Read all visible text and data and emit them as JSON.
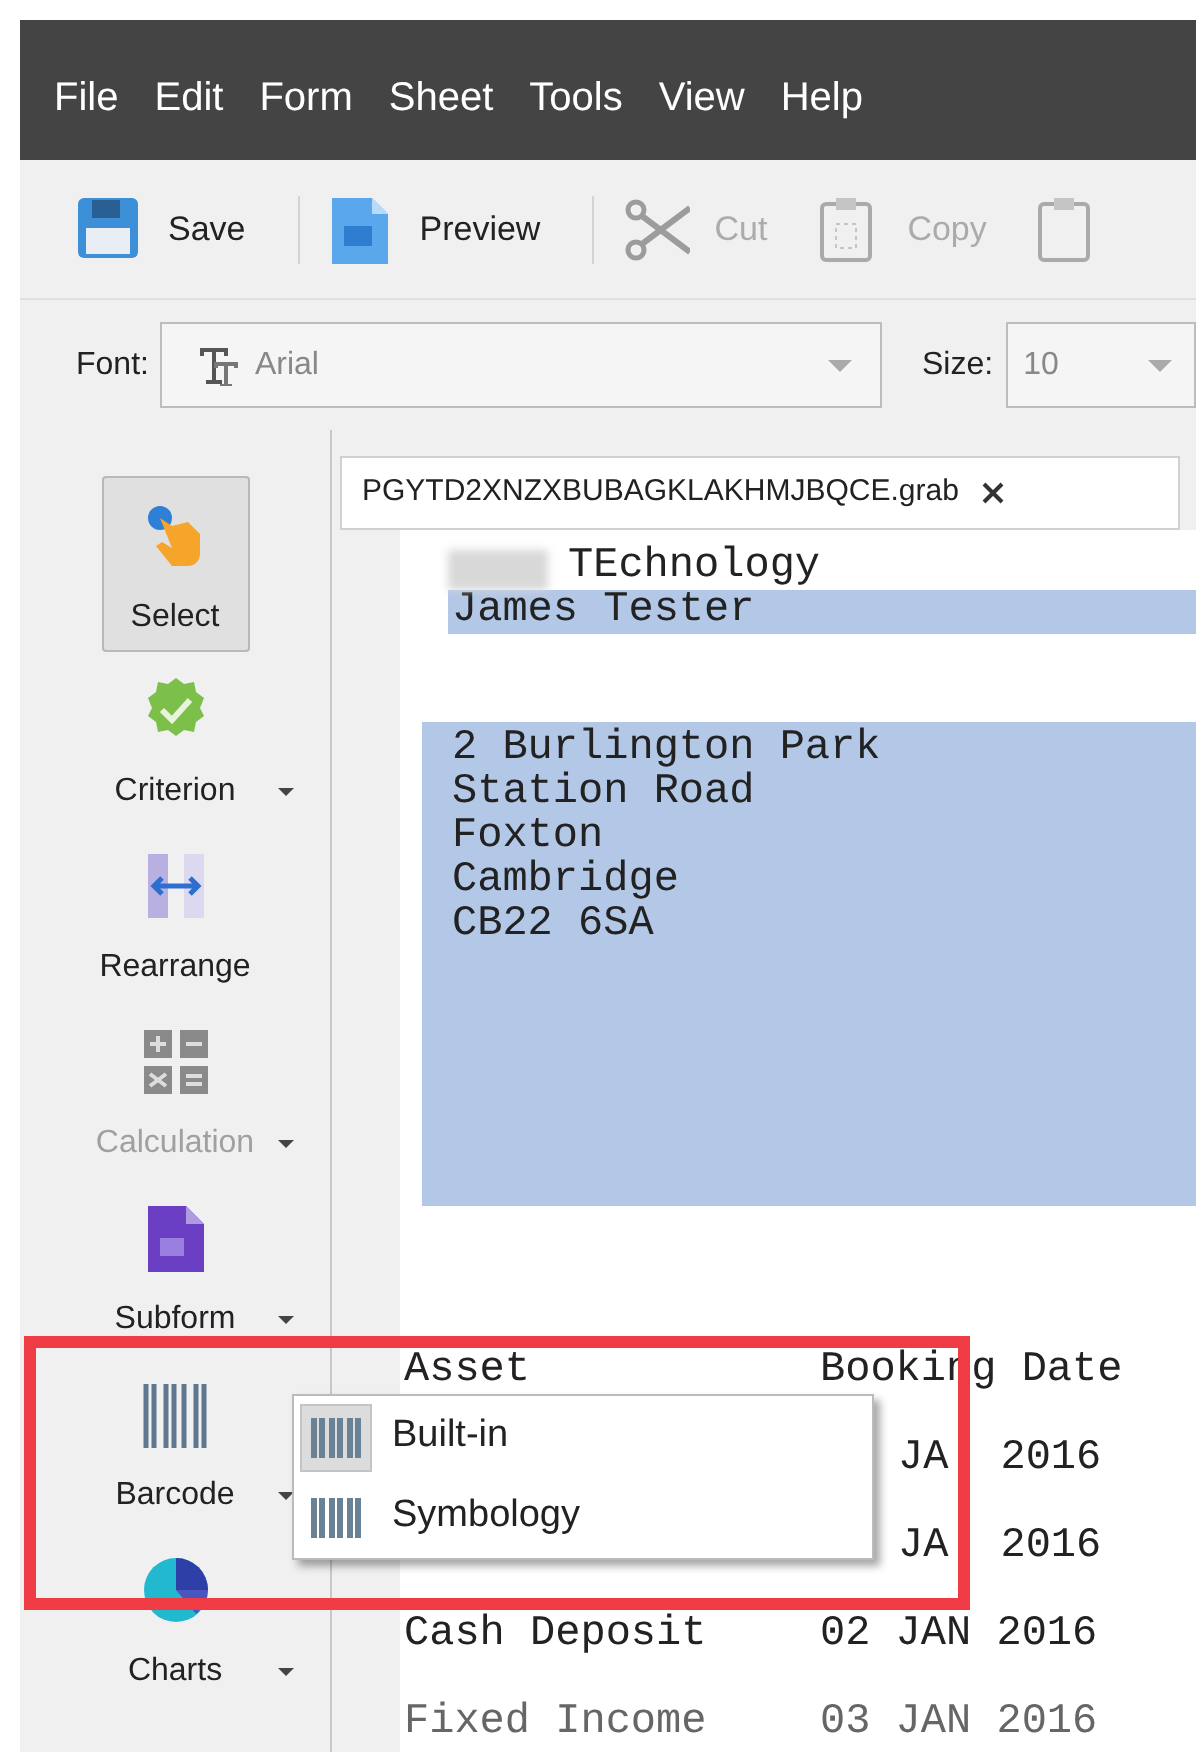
{
  "menu_bar": [
    "File",
    "Edit",
    "Form",
    "Sheet",
    "Tools",
    "View",
    "Help"
  ],
  "toolbar": [
    {
      "kind": "save",
      "label": "Save",
      "disabled": false
    },
    {
      "kind": "preview",
      "label": "Preview",
      "disabled": false
    },
    {
      "kind": "cut",
      "label": "Cut",
      "disabled": true
    },
    {
      "kind": "copy",
      "label": "Copy",
      "disabled": true
    },
    {
      "kind": "clipboard",
      "disabled": true
    }
  ],
  "format_bar": {
    "font_label": "Font:",
    "font": "Arial",
    "size_label": "Size:",
    "size": "10"
  },
  "tools": [
    {
      "kind": "select",
      "label": "Select",
      "selected": true,
      "disabled": false,
      "dropdown": false
    },
    {
      "kind": "criterion",
      "label": "Criterion",
      "selected": false,
      "disabled": false,
      "dropdown": true
    },
    {
      "kind": "rearrange",
      "label": "Rearrange",
      "selected": false,
      "disabled": false,
      "dropdown": false
    },
    {
      "kind": "calculation",
      "label": "Calculation",
      "selected": false,
      "disabled": true,
      "dropdown": true
    },
    {
      "kind": "subform",
      "label": "Subform",
      "selected": false,
      "disabled": false,
      "dropdown": true
    },
    {
      "kind": "barcode",
      "label": "Barcode",
      "selected": false,
      "disabled": false,
      "dropdown": true
    },
    {
      "kind": "charts",
      "label": "Charts",
      "selected": false,
      "disabled": false,
      "dropdown": true
    }
  ],
  "document": {
    "tab": "PGYTD2XNZXBUBAGKLAKHMJBQCE.grab",
    "company": "TEchnology",
    "name": "James Tester",
    "address": [
      "2 Burlington Park",
      "Station Road",
      "Foxton",
      "Cambridge",
      "CB22 6SA"
    ],
    "columns": [
      "Asset",
      "Booking Date"
    ],
    "rows": [
      [
        "",
        "JA",
        "2016"
      ],
      [
        "",
        "JA",
        "2016"
      ],
      [
        "Cash Deposit",
        "02 JAN 2016"
      ],
      [
        "Fixed Income",
        "03 JAN 2016"
      ]
    ]
  },
  "barcode_menu": [
    {
      "label": "Built-in",
      "selected": true
    },
    {
      "label": "Symbology",
      "selected": false
    }
  ],
  "highlight": true
}
